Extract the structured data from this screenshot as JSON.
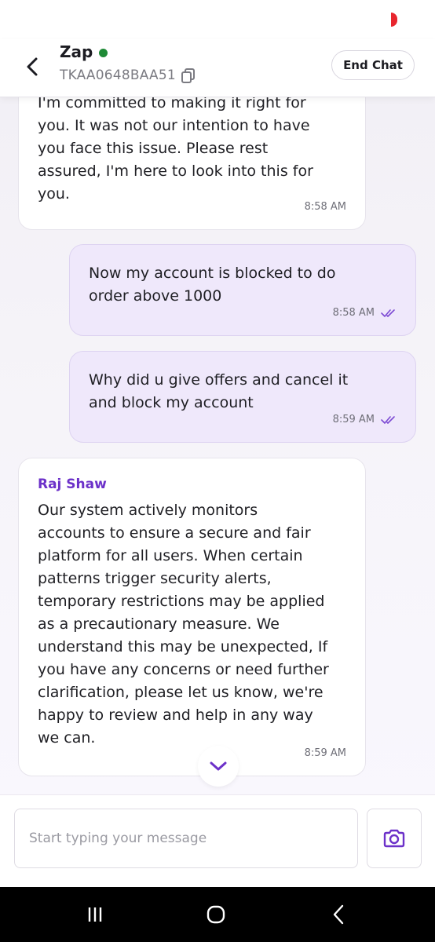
{
  "header": {
    "agent_name": "Zap",
    "ticket_id": "TKAA0648BAA51",
    "end_chat_label": "End Chat"
  },
  "messages": [
    {
      "from": "agent",
      "text": "I'm committed to making it right for\nyou. It was not our intention to have\nyou face this issue. Please rest\nassured, I'm here to look into this for\nyou.",
      "time": "8:58 AM"
    },
    {
      "from": "user",
      "text": "Now my account is blocked to do\norder above 1000",
      "time": "8:58 AM",
      "status": "read"
    },
    {
      "from": "user",
      "text": "Why did u give offers and cancel it\nand block my account",
      "time": "8:59 AM",
      "status": "read"
    },
    {
      "from": "agent",
      "sender": "Raj Shaw",
      "text": "Our system actively monitors\naccounts to ensure a secure and fair\nplatform for all users. When certain\npatterns trigger security alerts,\ntemporary restrictions may be applied\nas a precautionary measure. We\nunderstand this may be unexpected, If\nyou have any concerns or need further\nclarification, please let us know, we're\nhappy to review and help in any way\nwe can.",
      "time": "8:59 AM"
    }
  ],
  "composer": {
    "placeholder": "Start typing your message",
    "value": ""
  },
  "icons": {
    "back": "chevron-left-icon",
    "copy": "copy-icon",
    "online": "online-status-icon",
    "scroll": "chevron-down-icon",
    "camera": "camera-icon",
    "ticks": "double-check-icon"
  },
  "colors": {
    "accent": "#6c31c9",
    "user_bubble": "#efe8fb",
    "online": "#1f8a36",
    "status_dot": "#e8262e"
  }
}
